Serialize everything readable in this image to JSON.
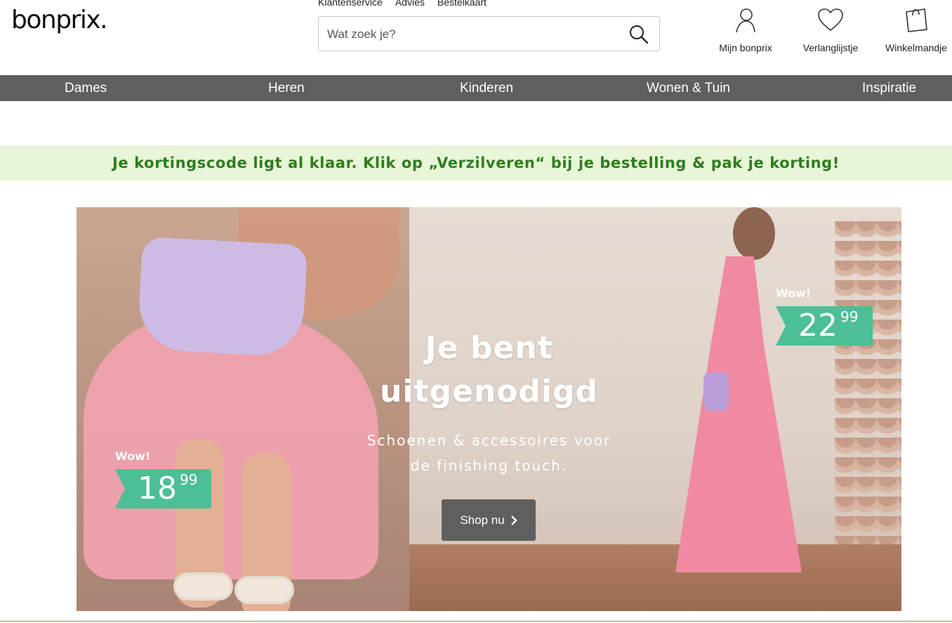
{
  "brand": {
    "logo_text": "bonprix."
  },
  "service_links": [
    "Klantenservice",
    "Advies",
    "Bestelkaart"
  ],
  "search": {
    "placeholder": "Wat zoek je?"
  },
  "account": {
    "mijn_label": "Mijn bonprix",
    "wishlist_label": "Verlanglijstje",
    "cart_label": "Winkelmandje"
  },
  "nav": {
    "items": [
      "Dames",
      "Heren",
      "Kinderen",
      "Wonen & Tuin",
      "Inspiratie"
    ]
  },
  "promo": {
    "text": "Je kortingscode ligt al klaar. Klik op „Verzilveren“ bij je bestelling & pak je korting!"
  },
  "hero": {
    "title_line1": "Je bent",
    "title_line2": "uitgenodigd",
    "subtitle_line1": "Schoenen & accessoires voor",
    "subtitle_line2": "de finishing touch.",
    "button_label": "Shop nu",
    "price_left": {
      "wow": "Wow!",
      "int": "18",
      "cents": "99"
    },
    "price_right": {
      "wow": "Wow!",
      "int": "22",
      "cents": "99"
    }
  },
  "colors": {
    "nav_bg": "#5f5f5f",
    "promo_bg": "#e8f5d8",
    "promo_text": "#2e7d1e",
    "price_tag": "#4cbf94"
  },
  "icons": [
    "search-icon",
    "user-icon",
    "heart-icon",
    "shopping-bag-icon",
    "chevron-right-icon"
  ]
}
